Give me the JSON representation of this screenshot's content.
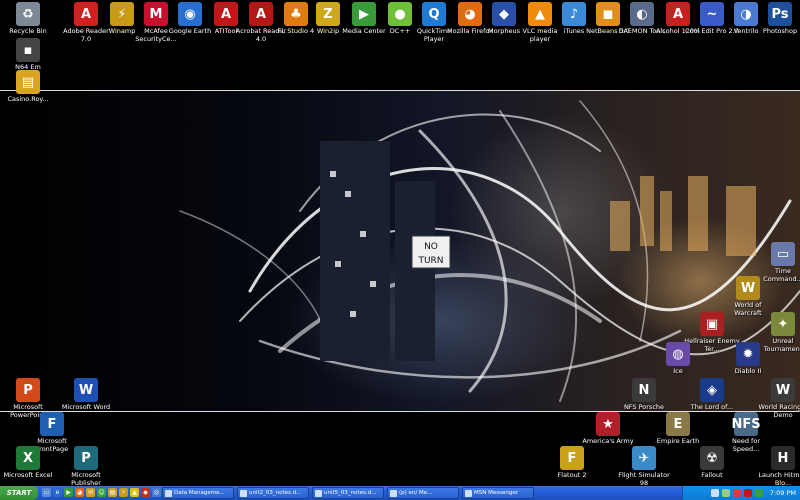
{
  "colors": {
    "taskbar": "#245edb",
    "start": "#2f8f2f",
    "tray": "#0f7bd6"
  },
  "desktop_icons": [
    {
      "label": "Recycle Bin",
      "icon": "recycle-bin-icon",
      "glyph": "♻",
      "color": "#7d8a96"
    },
    {
      "label": "N64 Em",
      "icon": "n64-emulator-icon",
      "glyph": "▪",
      "color": "#444"
    },
    {
      "label": "Casino.Roy...",
      "icon": "zip-archive-icon",
      "glyph": "▤",
      "color": "#d9a520"
    },
    {
      "label": "Adobe Reader 7.0",
      "icon": "adobe-reader-icon",
      "glyph": "A",
      "color": "#d21f1f"
    },
    {
      "label": "Winamp",
      "icon": "winamp-icon",
      "glyph": "⚡",
      "color": "#c79a1a"
    },
    {
      "label": "McAfee SecurityCe...",
      "icon": "mcafee-icon",
      "glyph": "M",
      "color": "#c8102e"
    },
    {
      "label": "Google Earth",
      "icon": "google-earth-icon",
      "glyph": "◉",
      "color": "#2a6fd0"
    },
    {
      "label": "ATITool",
      "icon": "atitool-icon",
      "glyph": "A",
      "color": "#c01818"
    },
    {
      "label": "Acrobat Reader 4.0",
      "icon": "acrobat-reader-icon",
      "glyph": "A",
      "color": "#b51616"
    },
    {
      "label": "FL Studio 4",
      "icon": "fl-studio-icon",
      "glyph": "♣",
      "color": "#e07b12"
    },
    {
      "label": "Win2ip",
      "icon": "winzip-icon",
      "glyph": "Z",
      "color": "#cfa81a"
    },
    {
      "label": "Media Center",
      "icon": "media-center-icon",
      "glyph": "▶",
      "color": "#3a9a3a"
    },
    {
      "label": "DC++",
      "icon": "dcplusplus-icon",
      "glyph": "●",
      "color": "#6fbf3a"
    },
    {
      "label": "QuickTime Player",
      "icon": "quicktime-icon",
      "glyph": "Q",
      "color": "#1f7ad6"
    },
    {
      "label": "Mozilla Firefox",
      "icon": "firefox-icon",
      "glyph": "◕",
      "color": "#e36a12"
    },
    {
      "label": "Morpheus",
      "icon": "morpheus-icon",
      "glyph": "◆",
      "color": "#2a4fa8"
    },
    {
      "label": "VLC media player",
      "icon": "vlc-icon",
      "glyph": "▲",
      "color": "#f08a0c"
    },
    {
      "label": "iTunes",
      "icon": "itunes-icon",
      "glyph": "♪",
      "color": "#3a8ad6"
    },
    {
      "label": "NetBeans 5.0",
      "icon": "netbeans-icon",
      "glyph": "◼",
      "color": "#e0901a"
    },
    {
      "label": "DAEMON Tools",
      "icon": "daemon-tools-icon",
      "glyph": "◐",
      "color": "#5a6a8a"
    },
    {
      "label": "Alcohol 120%",
      "icon": "alcohol-icon",
      "glyph": "A",
      "color": "#c82020"
    },
    {
      "label": "Cool Edit Pro 2.0",
      "icon": "cool-edit-icon",
      "glyph": "~",
      "color": "#3a5ac8"
    },
    {
      "label": "Ventrilo",
      "icon": "ventrilo-icon",
      "glyph": "◑",
      "color": "#4a7ad0"
    },
    {
      "label": "Photoshop",
      "icon": "photoshop-icon",
      "glyph": "Ps",
      "color": "#1e4f9a"
    },
    {
      "label": "Time Command...",
      "icon": "time-command-icon",
      "glyph": "▭",
      "color": "#6a7aa8"
    },
    {
      "label": "World of Warcraft",
      "icon": "world-of-warcraft-icon",
      "glyph": "W",
      "color": "#b08a1a"
    },
    {
      "label": "Unreal Tournament",
      "icon": "unreal-tournament-icon",
      "glyph": "✦",
      "color": "#7a8a3a"
    },
    {
      "label": "Hellraiser Enemy Ter...",
      "icon": "game-icon",
      "glyph": "▣",
      "color": "#a82020"
    },
    {
      "label": "Ice",
      "icon": "ice-icon",
      "glyph": "◍",
      "color": "#6a4aa8"
    },
    {
      "label": "Diablo II",
      "icon": "diablo-icon",
      "glyph": "✹",
      "color": "#2a3a8a"
    },
    {
      "label": "NFS Porsche",
      "icon": "nfs-porsche-icon",
      "glyph": "N",
      "color": "#3a3a3a"
    },
    {
      "label": "The Lord of...",
      "icon": "lotr-icon",
      "glyph": "◈",
      "color": "#1a3a8a"
    },
    {
      "label": "World Racing 2 Demo",
      "icon": "world-racing-icon",
      "glyph": "W",
      "color": "#3a3a3a"
    },
    {
      "label": "Microsoft PowerPoint",
      "icon": "powerpoint-icon",
      "glyph": "P",
      "color": "#d24a1a"
    },
    {
      "label": "Microsoft Word",
      "icon": "word-icon",
      "glyph": "W",
      "color": "#1f4fb0"
    },
    {
      "label": "Microsoft FrontPage",
      "icon": "frontpage-icon",
      "glyph": "F",
      "color": "#1f5fb0"
    },
    {
      "label": "America's Army",
      "icon": "americas-army-icon",
      "glyph": "★",
      "color": "#b01f2a"
    },
    {
      "label": "Empire Earth",
      "icon": "empire-earth-icon",
      "glyph": "E",
      "color": "#8a7a4a"
    },
    {
      "label": "Need for Speed...",
      "icon": "need-for-speed-icon",
      "glyph": "NFS",
      "color": "#4a6a8a"
    },
    {
      "label": "Microsoft Excel",
      "icon": "excel-icon",
      "glyph": "X",
      "color": "#1f7a3a"
    },
    {
      "label": "Microsoft Publisher",
      "icon": "publisher-icon",
      "glyph": "P",
      "color": "#1f6a7a"
    },
    {
      "label": "Flatout 2",
      "icon": "flatout-icon",
      "glyph": "F",
      "color": "#c8a01a"
    },
    {
      "label": "Flight Simulator 98",
      "icon": "flight-simulator-icon",
      "glyph": "✈",
      "color": "#3a8ac8"
    },
    {
      "label": "Fallout",
      "icon": "fallout-icon",
      "glyph": "☢",
      "color": "#3a3a3a"
    },
    {
      "label": "Launch Hitman Blo...",
      "icon": "hitman-icon",
      "glyph": "H",
      "color": "#2a2a2a"
    }
  ],
  "wallpaper_sign": [
    "NO",
    "TURN"
  ],
  "taskbar": {
    "start_label": "START",
    "quick_launch": [
      {
        "icon": "show-desktop-icon",
        "glyph": "▭",
        "color": "#5a8ad6"
      },
      {
        "icon": "ie-icon",
        "glyph": "e",
        "color": "#2a6ad0"
      },
      {
        "icon": "media-player-icon",
        "glyph": "▶",
        "color": "#3a9a3a"
      },
      {
        "icon": "firefox-icon",
        "glyph": "◕",
        "color": "#e36a12"
      },
      {
        "icon": "outlook-icon",
        "glyph": "✉",
        "color": "#d0a020"
      },
      {
        "icon": "messenger-icon",
        "glyph": "☺",
        "color": "#3aa03a"
      },
      {
        "icon": "folder-icon",
        "glyph": "▤",
        "color": "#d0a020"
      },
      {
        "icon": "winamp-icon",
        "glyph": "⚡",
        "color": "#c79a1a"
      },
      {
        "icon": "aim-icon",
        "glyph": "▲",
        "color": "#e0c020"
      },
      {
        "icon": "game-icon",
        "glyph": "◆",
        "color": "#c03020"
      },
      {
        "icon": "search-icon",
        "glyph": "◎",
        "color": "#4a7ad0"
      }
    ],
    "tasks": [
      {
        "label": "Data Manageme..."
      },
      {
        "label": "unit2_03_notes.d..."
      },
      {
        "label": "unit5_03_notes.d..."
      },
      {
        "label": "(p) en/ Me..."
      },
      {
        "label": "MSN Messenger"
      }
    ],
    "tray_icons": [
      {
        "icon": "speaker-icon",
        "color": "#cfe0ff"
      },
      {
        "icon": "network-icon",
        "color": "#9ad07a"
      },
      {
        "icon": "antivirus-icon",
        "color": "#e03a3a"
      },
      {
        "icon": "ati-icon",
        "color": "#c01818"
      },
      {
        "icon": "messenger-tray-icon",
        "color": "#3aa03a"
      }
    ],
    "clock": "7:09 PM"
  }
}
